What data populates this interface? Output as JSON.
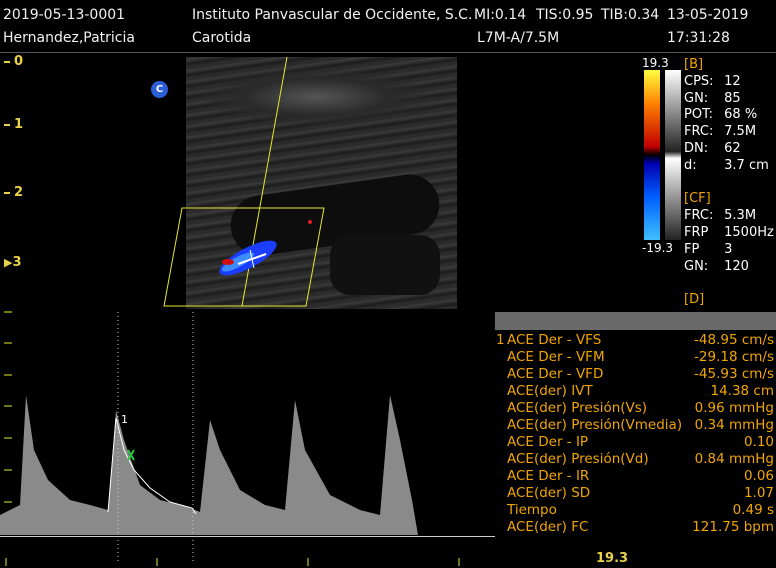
{
  "header": {
    "exam_id": "2019-05-13-0001",
    "institution": "Instituto Panvascular de Occidente, S.C.",
    "mi": "MI:0.14",
    "tis": "TIS:0.95",
    "tib": "TIB:0.34",
    "date": "13-05-2019",
    "patient": "Hernandez,Patricia",
    "exam": "Carotida",
    "probe": "L7M-A/7.5M",
    "time": "17:31:28"
  },
  "depth_marks": [
    "0",
    "1",
    "2",
    "3"
  ],
  "color_scale": {
    "top": "19.3",
    "bottom": "-19.3"
  },
  "b_params": {
    "section": "[B]",
    "rows": [
      {
        "k": "CPS:",
        "v": "12"
      },
      {
        "k": "GN:",
        "v": "85"
      },
      {
        "k": "POT:",
        "v": "68 %"
      },
      {
        "k": "FRC:",
        "v": "7.5M"
      },
      {
        "k": "DN:",
        "v": "62"
      },
      {
        "k": "d:",
        "v": "3.7 cm"
      }
    ]
  },
  "cf_params": {
    "section": "[CF]",
    "rows": [
      {
        "k": "FRC:",
        "v": "5.3M"
      },
      {
        "k": "FRP",
        "v": "1500Hz"
      },
      {
        "k": "FP",
        "v": "3"
      },
      {
        "k": "GN:",
        "v": "120"
      }
    ]
  },
  "d_params": {
    "section": "[D]"
  },
  "markers": {
    "c": "C",
    "cursor": "1"
  },
  "measurements": [
    {
      "n": "1",
      "label": "ACE Der - VFS",
      "value": "-48.95 cm/s"
    },
    {
      "n": "",
      "label": "ACE Der - VFM",
      "value": "-29.18 cm/s"
    },
    {
      "n": "",
      "label": "ACE Der - VFD",
      "value": "-45.93 cm/s"
    },
    {
      "n": "",
      "label": "ACE(der) IVT",
      "value": "14.38 cm"
    },
    {
      "n": "",
      "label": "ACE(der) Presión(Vs)",
      "value": "0.96 mmHg"
    },
    {
      "n": "",
      "label": "ACE(der) Presión(Vmedia)",
      "value": "0.34 mmHg"
    },
    {
      "n": "",
      "label": "ACE Der - IP",
      "value": "0.10"
    },
    {
      "n": "",
      "label": "ACE(der) Presión(Vd)",
      "value": "0.84 mmHg"
    },
    {
      "n": "",
      "label": "ACE Der - IR",
      "value": "0.06"
    },
    {
      "n": "",
      "label": "ACE(der) SD",
      "value": "1.07"
    },
    {
      "n": "",
      "label": "Tiempo",
      "value": "0.49 s"
    },
    {
      "n": "",
      "label": "ACE(der) FC",
      "value": "121.75 bpm"
    }
  ],
  "doppler_scale": "19.3"
}
